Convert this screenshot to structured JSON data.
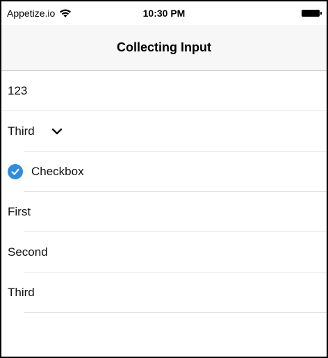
{
  "status_bar": {
    "carrier": "Appetize.io",
    "time": "10:30 PM"
  },
  "nav": {
    "title": "Collecting Input"
  },
  "form": {
    "text_input_value": "123",
    "select": {
      "selected": "Third"
    },
    "checkbox": {
      "label": "Checkbox",
      "checked": true
    },
    "list_items": [
      "First",
      "Second",
      "Third"
    ]
  },
  "colors": {
    "accent": "#2f8cde",
    "nav_background": "#f7f7f7"
  }
}
